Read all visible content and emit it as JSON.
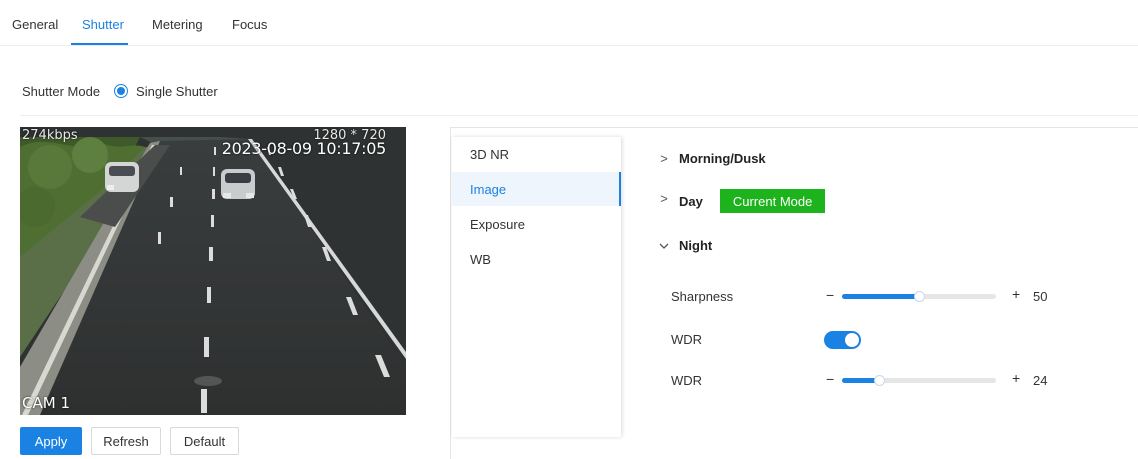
{
  "tabs": [
    {
      "label": "General",
      "active": false
    },
    {
      "label": "Shutter",
      "active": true
    },
    {
      "label": "Metering",
      "active": false
    },
    {
      "label": "Focus",
      "active": false
    }
  ],
  "shutter": {
    "mode_label": "Shutter Mode",
    "selected_option": "Single Shutter"
  },
  "video": {
    "bitrate": "274kbps",
    "resolution": "1280 * 720",
    "timestamp": "2023-08-09 10:17:05",
    "camera_label": "CAM 1"
  },
  "buttons": {
    "apply": "Apply",
    "refresh": "Refresh",
    "default": "Default"
  },
  "menu": [
    {
      "label": "3D NR",
      "active": false
    },
    {
      "label": "Image",
      "active": true
    },
    {
      "label": "Exposure",
      "active": false
    },
    {
      "label": "WB",
      "active": false
    }
  ],
  "sections": {
    "morning": {
      "title": "Morning/Dusk",
      "icon": "chevron-right-icon",
      "expanded": false
    },
    "day": {
      "title": "Day",
      "icon": "chevron-right-icon",
      "expanded": false,
      "badge": "Current Mode"
    },
    "night": {
      "title": "Night",
      "icon": "chevron-down-icon",
      "expanded": true
    }
  },
  "night_settings": {
    "sharpness": {
      "label": "Sharpness",
      "value": 50,
      "display_value": "50",
      "min": 0,
      "max": 100
    },
    "wdr_toggle": {
      "label": "WDR",
      "enabled": true
    },
    "wdr_level": {
      "label": "WDR",
      "value": 24,
      "display_value": "24",
      "min": 0,
      "max": 100
    }
  },
  "colors": {
    "accent": "#1a82e2",
    "current_mode_badge": "#1db31d"
  }
}
